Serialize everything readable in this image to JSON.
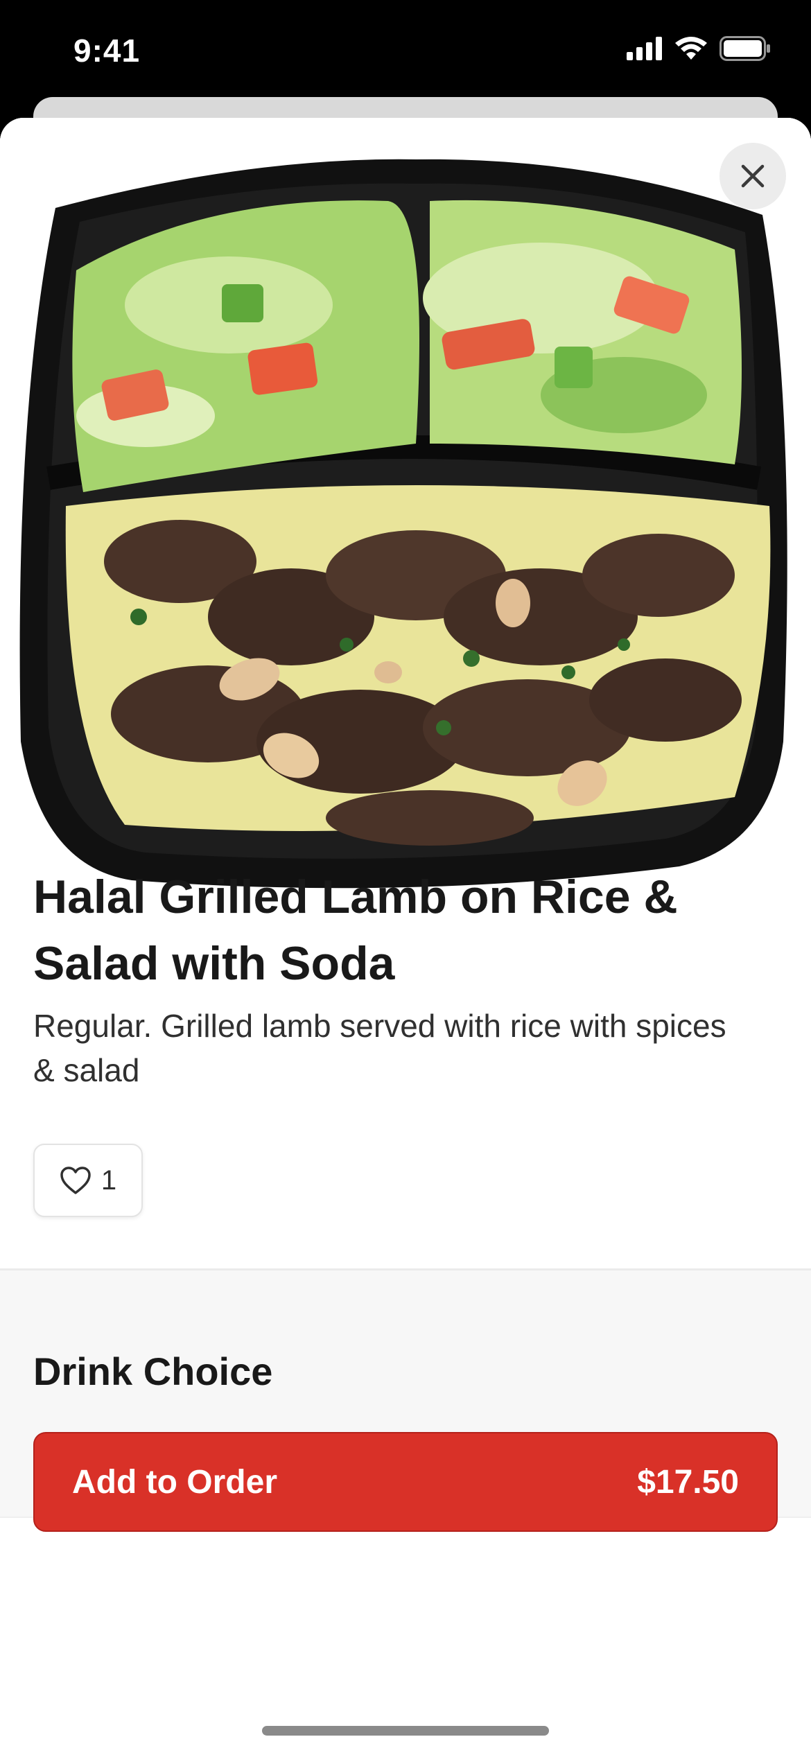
{
  "status_bar": {
    "time": "9:41"
  },
  "item": {
    "title": "Halal Grilled Lamb on Rice & Salad with Soda",
    "description": "Regular. Grilled lamb served with rice with spices & salad",
    "likes": "1"
  },
  "sections": {
    "drink_choice": "Drink Choice"
  },
  "cta": {
    "label": "Add to Order",
    "price": "$17.50",
    "color": "#d93128"
  },
  "icons": [
    "signal-icon",
    "wifi-icon",
    "battery-icon",
    "close-icon",
    "heart-icon"
  ]
}
